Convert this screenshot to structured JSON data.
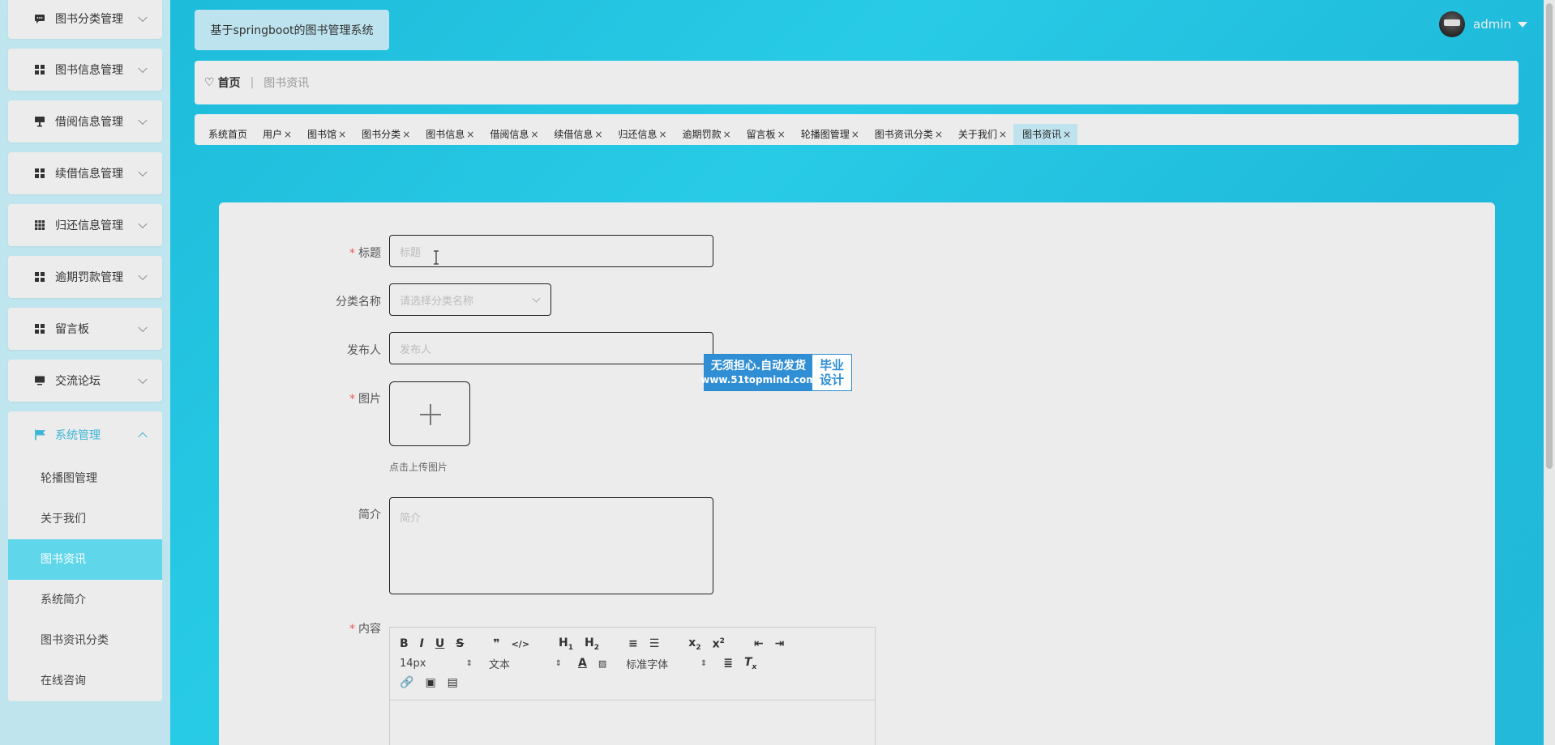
{
  "sidebar": {
    "items": [
      {
        "label": "图书分类管理",
        "icon": "chat-icon"
      },
      {
        "label": "图书信息管理",
        "icon": "grid-icon"
      },
      {
        "label": "借阅信息管理",
        "icon": "monitor-stand-icon"
      },
      {
        "label": "续借信息管理",
        "icon": "grid-icon"
      },
      {
        "label": "归还信息管理",
        "icon": "grid-9-icon"
      },
      {
        "label": "逾期罚款管理",
        "icon": "grid-icon"
      },
      {
        "label": "留言板",
        "icon": "grid-icon"
      },
      {
        "label": "交流论坛",
        "icon": "monitor-icon"
      }
    ],
    "group": {
      "label": "系统管理",
      "icon": "flag-icon",
      "sub": [
        "轮播图管理",
        "关于我们",
        "图书资讯",
        "系统简介",
        "图书资讯分类",
        "在线咨询"
      ],
      "active_index": 2
    }
  },
  "header": {
    "title": "基于springboot的图书管理系统",
    "user": "admin"
  },
  "breadcrumb": {
    "home": "首页",
    "separator": "|",
    "current": "图书资讯"
  },
  "tabs": [
    "系统首页",
    "用户",
    "图书馆",
    "图书分类",
    "图书信息",
    "借阅信息",
    "续借信息",
    "归还信息",
    "逾期罚款",
    "留言板",
    "轮播图管理",
    "图书资讯分类",
    "关于我们",
    "图书资讯"
  ],
  "form": {
    "title_label": "标题",
    "title_placeholder": "标题",
    "category_label": "分类名称",
    "category_placeholder": "请选择分类名称",
    "publisher_label": "发布人",
    "publisher_placeholder": "发布人",
    "image_label": "图片",
    "upload_tip": "点击上传图片",
    "summary_label": "简介",
    "summary_placeholder": "简介",
    "content_label": "内容",
    "editor": {
      "font_size": "14px",
      "text_style": "文本",
      "font_family": "标准字体"
    }
  },
  "watermark": {
    "line1": "无须担心.自动发货",
    "line2": "www.51topmind.com",
    "right1": "毕业",
    "right2": "设计"
  },
  "colors": {
    "accent": "#3bb6d6",
    "active_bg": "#5fd6ea",
    "background": "#1fbadb",
    "required": "#e55555"
  }
}
